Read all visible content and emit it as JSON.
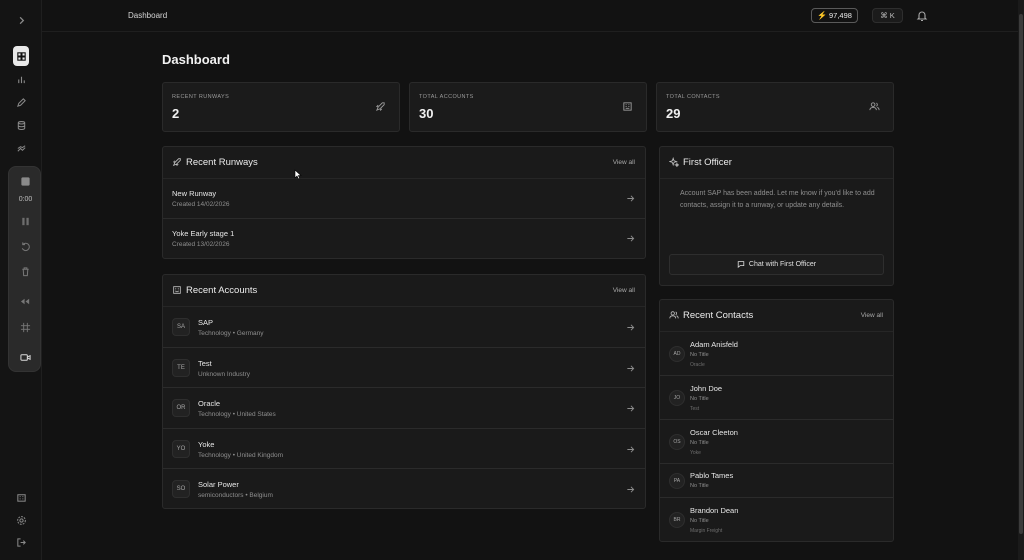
{
  "topbar": {
    "breadcrumb": "Dashboard",
    "credits": "97,498",
    "shortcut": "⌘ K"
  },
  "recorder": {
    "time": "0:00"
  },
  "page": {
    "title": "Dashboard"
  },
  "stats": [
    {
      "label": "RECENT RUNWAYS",
      "value": "2",
      "icon": "rocket-icon"
    },
    {
      "label": "TOTAL ACCOUNTS",
      "value": "30",
      "icon": "building-icon"
    },
    {
      "label": "TOTAL CONTACTS",
      "value": "29",
      "icon": "users-icon"
    }
  ],
  "runways": {
    "title": "Recent Runways",
    "view_all": "View all",
    "items": [
      {
        "name": "New Runway",
        "created": "Created 14/02/2026"
      },
      {
        "name": "Yoke Early stage 1",
        "created": "Created 13/02/2026"
      }
    ]
  },
  "accounts": {
    "title": "Recent Accounts",
    "view_all": "View all",
    "items": [
      {
        "initials": "SA",
        "name": "SAP",
        "meta": "Technology • Germany"
      },
      {
        "initials": "TE",
        "name": "Test",
        "meta": "Unknown Industry"
      },
      {
        "initials": "OR",
        "name": "Oracle",
        "meta": "Technology • United States"
      },
      {
        "initials": "YO",
        "name": "Yoke",
        "meta": "Technology • United Kingdom"
      },
      {
        "initials": "SO",
        "name": "Solar Power",
        "meta": "semiconductors • Belgium"
      }
    ]
  },
  "first_officer": {
    "title": "First Officer",
    "message": "Account SAP has been added. Let me know if you'd like to add contacts, assign it to a runway, or update any details.",
    "chat_button": "Chat with First Officer"
  },
  "contacts": {
    "title": "Recent Contacts",
    "view_all": "View all",
    "items": [
      {
        "initials": "AD",
        "name": "Adam Anisfeld",
        "role": "No Title",
        "company": "Oracle"
      },
      {
        "initials": "JO",
        "name": "John Doe",
        "role": "No Title",
        "company": "Test"
      },
      {
        "initials": "OS",
        "name": "Oscar Cleeton",
        "role": "No Title",
        "company": "Yoke"
      },
      {
        "initials": "PA",
        "name": "Pablo Tames",
        "role": "No Title",
        "company": ""
      },
      {
        "initials": "BR",
        "name": "Brandon Dean",
        "role": "No Title",
        "company": "Margin Freight"
      }
    ]
  }
}
